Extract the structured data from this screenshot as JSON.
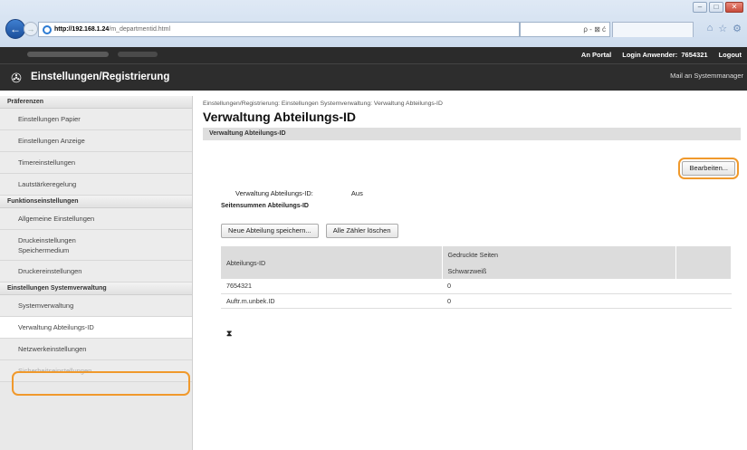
{
  "browser": {
    "url_host": "http://192.168.1.24",
    "url_path": "/m_departmentid.html",
    "search_text": "ρ - ⊠ ć"
  },
  "header": {
    "portal_link": "An Portal",
    "login_label": "Login Anwender:",
    "login_user": "7654321",
    "logout": "Logout",
    "app_title": "Einstellungen/Registrierung",
    "mail_link": "Mail an Systemmanager"
  },
  "sidebar": {
    "sections": [
      {
        "title": "Präferenzen",
        "items": [
          "Einstellungen Papier",
          "Einstellungen Anzeige",
          "Timereinstellungen",
          "Lautstärkeregelung"
        ]
      },
      {
        "title": "Funktionseinstellungen",
        "items": [
          "Allgemeine Einstellungen",
          "Druckeinstellungen Speichermedium",
          "Druckereinstellungen"
        ]
      },
      {
        "title": "Einstellungen Systemverwaltung",
        "items": [
          "Systemverwaltung",
          "Verwaltung Abteilungs-ID",
          "Netzwerkeinstellungen",
          "Sicherheitseinstellungen"
        ]
      }
    ]
  },
  "main": {
    "breadcrumb": "Einstellungen/Registrierung: Einstellungen Systemverwaltung: Verwaltung Abteilungs-ID",
    "title": "Verwaltung Abteilungs-ID",
    "section_title": "Verwaltung Abteilungs-ID",
    "edit_button": "Bearbeiten...",
    "mgmt_label": "Verwaltung Abteilungs-ID:",
    "mgmt_value": "Aus",
    "subhead": "Seitensummen Abteilungs-ID",
    "save_button": "Neue Abteilung speichern...",
    "clear_button": "Alle Zähler löschen",
    "table": {
      "col1": "Abteilungs-ID",
      "col2_top": "Gedruckte Seiten",
      "col2_bottom": "Schwarzweiß",
      "rows": [
        {
          "id": "7654321",
          "count": "0"
        },
        {
          "id": "Auftr.m.unbek.ID",
          "count": "0"
        }
      ]
    },
    "top_arrow": "⧗"
  }
}
